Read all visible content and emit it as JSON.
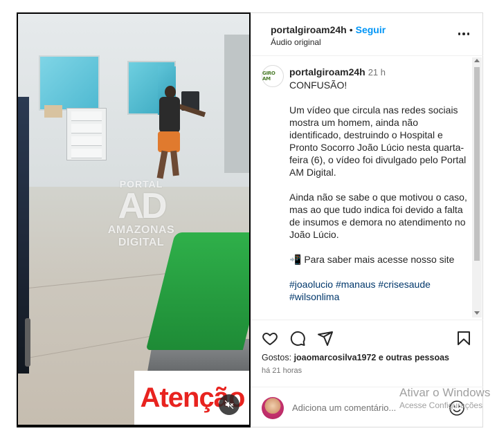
{
  "video": {
    "watermark_top": "PORTAL",
    "watermark_logo": "AD",
    "watermark_bottom1": "AMAZONAS",
    "watermark_bottom2": "DIGITAL",
    "overlay_text": "Atenção"
  },
  "header": {
    "username": "portalgiroam24h",
    "separator": "•",
    "follow_label": "Seguir",
    "audio_label": "Áudio original"
  },
  "caption": {
    "avatar_text": "GIRO AM",
    "username": "portalgiroam24h",
    "time": "21 h",
    "title": "CONFUSÃO!",
    "paragraph1": "Um vídeo que circula nas redes sociais mostra um homem, ainda não identificado, destruindo o Hospital e Pronto Socorro João Lúcio nesta quarta-feira (6), o vídeo foi divulgado pelo Portal AM Digital.",
    "paragraph2": "Ainda não se sabe o que motivou o caso, mas ao que tudo indica foi devido a falta de insumos e demora no atendimento no João Lúcio.",
    "site_line": "📲 Para saber mais acesse nosso site",
    "hashtags1": "#joaolucio #manaus #crisesaude",
    "hashtags2": "#wilsonlima"
  },
  "actions": {
    "likes_prefix": "Gostos:",
    "likes_user": "joaomarcosilva1972",
    "likes_suffix": "e outras pessoas",
    "time_ago": "há 21 horas"
  },
  "comment": {
    "placeholder": "Adiciona um comentário..."
  },
  "windows_watermark": {
    "title": "Ativar o Windows",
    "subtitle": "Acesse Configurações"
  },
  "colors": {
    "follow": "#0095f6",
    "hashtag": "#00376b",
    "overlay_red": "#e8231f"
  },
  "icons": [
    "heart-icon",
    "comment-icon",
    "share-icon",
    "bookmark-icon",
    "mute-icon",
    "more-icon",
    "emoji-icon"
  ]
}
